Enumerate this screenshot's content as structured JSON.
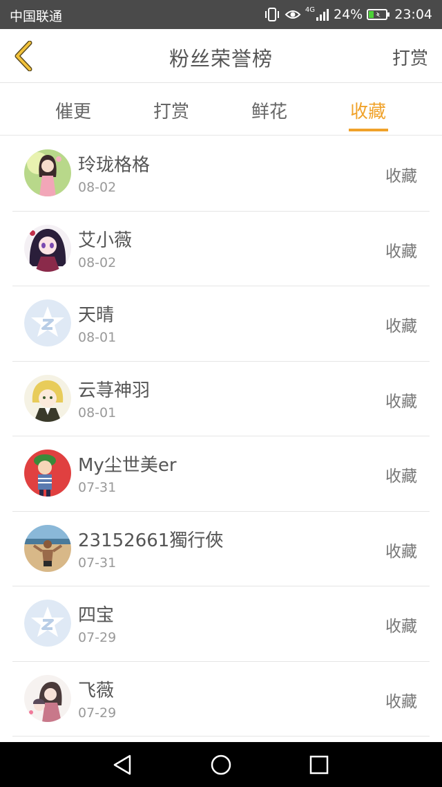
{
  "status_bar": {
    "carrier": "中国联通",
    "network": "4G",
    "battery": "24%",
    "time": "23:04"
  },
  "header": {
    "title": "粉丝荣誉榜",
    "action": "打赏"
  },
  "tabs": [
    {
      "label": "催更",
      "active": false
    },
    {
      "label": "打赏",
      "active": false
    },
    {
      "label": "鲜花",
      "active": false
    },
    {
      "label": "收藏",
      "active": true
    }
  ],
  "accent_color": "#f0a22a",
  "fans": [
    {
      "name": "玲珑格格",
      "date": "08-02",
      "action": "收藏",
      "avatar": "girl-portrait-avatar"
    },
    {
      "name": "艾小薇",
      "date": "08-02",
      "action": "收藏",
      "avatar": "anime-girl-avatar"
    },
    {
      "name": "天晴",
      "date": "08-01",
      "action": "收藏",
      "avatar": "default-star-avatar"
    },
    {
      "name": "云荨神羽",
      "date": "08-01",
      "action": "收藏",
      "avatar": "anime-boy-avatar"
    },
    {
      "name": "My尘世美er",
      "date": "07-31",
      "action": "收藏",
      "avatar": "cartoon-boy-avatar"
    },
    {
      "name": "23152661獨行俠",
      "date": "07-31",
      "action": "收藏",
      "avatar": "beach-photo-avatar"
    },
    {
      "name": "四宝",
      "date": "07-29",
      "action": "收藏",
      "avatar": "default-star-avatar"
    },
    {
      "name": "飞薇",
      "date": "07-29",
      "action": "收藏",
      "avatar": "anime-couple-avatar"
    }
  ]
}
